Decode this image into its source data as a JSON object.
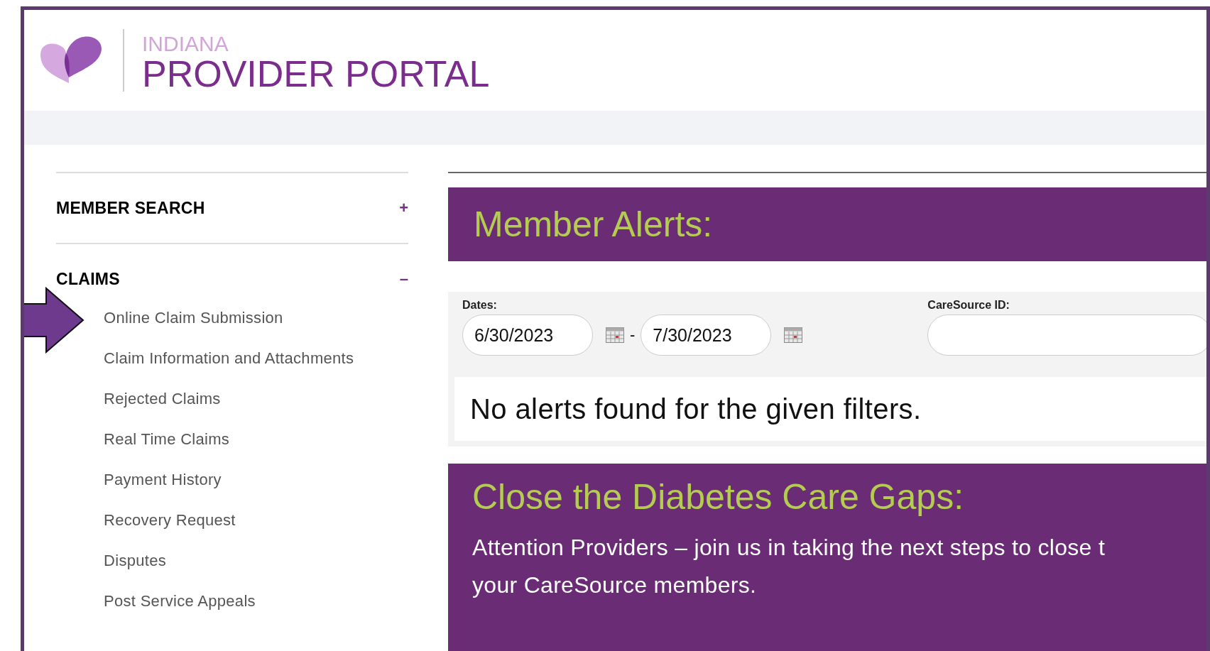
{
  "header": {
    "region": "INDIANA",
    "title": "PROVIDER PORTAL"
  },
  "sidebar": {
    "sections": [
      {
        "label": "MEMBER SEARCH",
        "toggle": "+"
      },
      {
        "label": "CLAIMS",
        "toggle": "–",
        "items": [
          "Online Claim Submission",
          "Claim Information and Attachments",
          "Rejected Claims",
          "Real Time Claims",
          "Payment History",
          "Recovery Request",
          "Disputes",
          "Post Service Appeals"
        ]
      }
    ]
  },
  "member_alerts": {
    "title": "Member Alerts:",
    "dates_label": "Dates:",
    "date_from": "6/30/2023",
    "date_separator": "-",
    "date_to": "7/30/2023",
    "caresource_id_label": "CareSource ID:",
    "message": "No alerts found for the given filters."
  },
  "diabetes": {
    "title": "Close the Diabetes Care Gaps:",
    "lines": [
      "Attention Providers – join us in taking the next steps to close t",
      "your CareSource members."
    ]
  }
}
